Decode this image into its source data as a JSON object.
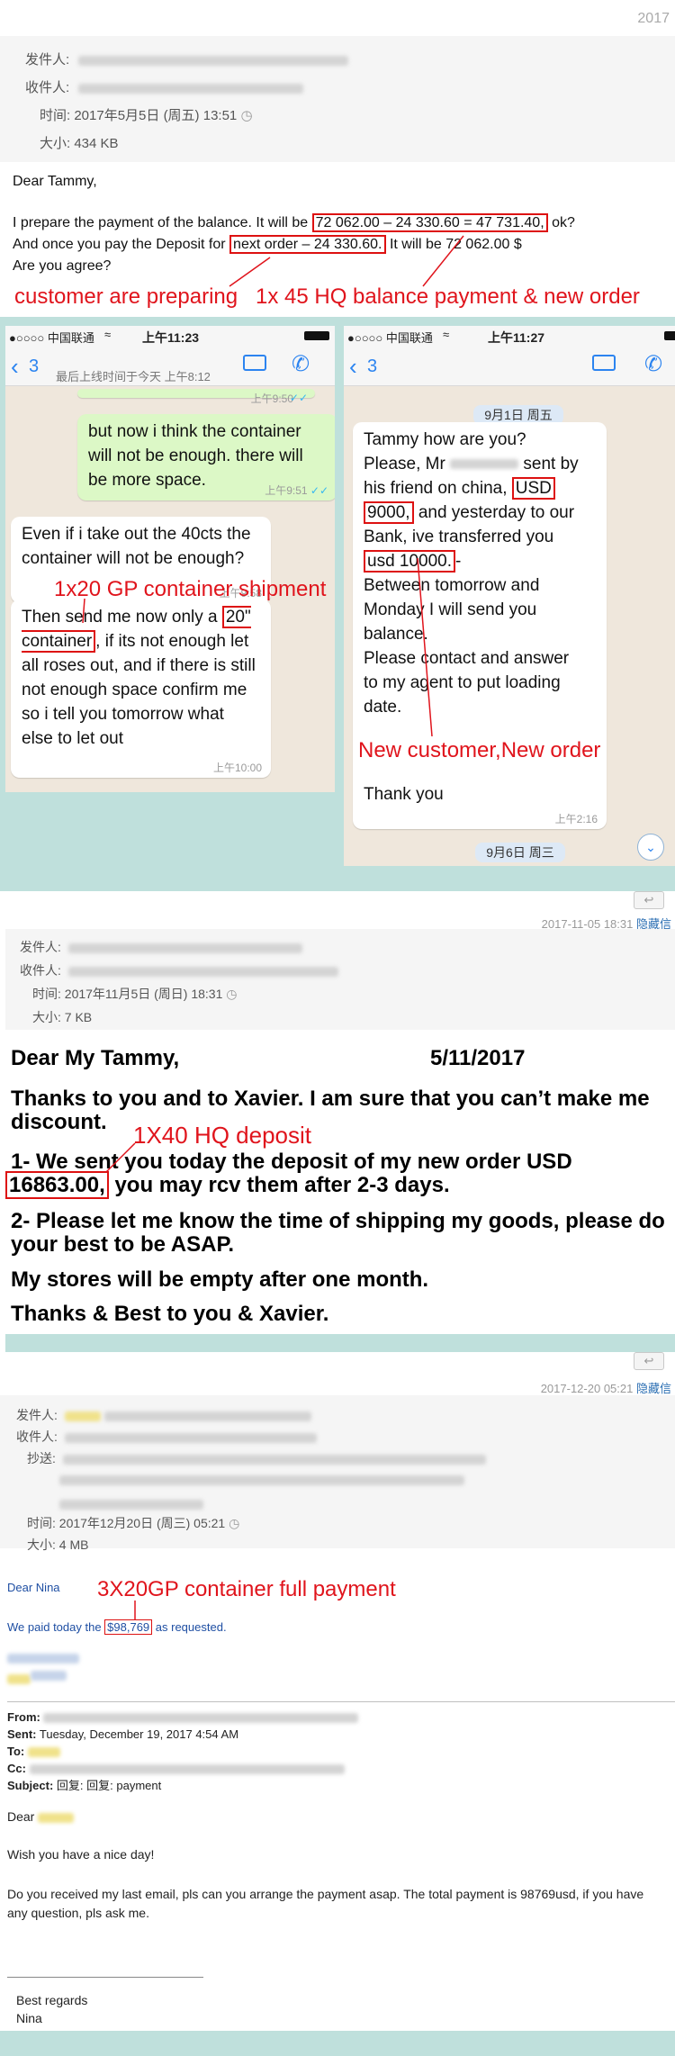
{
  "email1": {
    "year_corner": "2017",
    "from_label": "发件人:",
    "to_label": "收件人:",
    "time_label": "时间:",
    "time_value": "2017年5月5日 (周五) 13:51",
    "size_label": "大小:",
    "size_value": "434 KB",
    "greeting": "Dear Tammy,",
    "line1_a": "I prepare the payment of the balance. It will be ",
    "line1_box": "72 062.00 – 24 330.60 = 47 731.40,",
    "line1_b": " ok?",
    "line2_a": "And once you pay the Deposit for ",
    "line2_box": "next order – 24 330.60.",
    "line2_b": " It will be 72 062.00 $",
    "line3": "Are you agree?",
    "annotation_left": "customer are preparing",
    "annotation_right": "1x 45 HQ balance payment & new order"
  },
  "phone_left": {
    "carrier": "●○○○○ 中国联通",
    "time": "上午11:23",
    "back_count": "3",
    "last_seen": "最后上线时间于今天 上午8:12",
    "top_time": "上午9:50",
    "msg_out": "but now i think the container will not be enough. there will be  more space.",
    "msg_out_time": "上午9:51",
    "msg_in1": "Even if i take out the 40cts the container will not be enough?",
    "msg_in1_time": "上午9:58",
    "msg_in2_a": "Then send me now only a ",
    "msg_in2_box": "20\" container",
    "msg_in2_b": ", if its not enough let all roses out, and if there is still not enough space confirm me so i tell you tomorrow what else to let out",
    "msg_in2_time": "上午10:00",
    "annotation": "1x20 GP container shipment"
  },
  "phone_right": {
    "carrier": "●○○○○ 中国联通",
    "time": "上午11:27",
    "back_count": "3",
    "day1": "9月1日 周五",
    "msg_l1": "Tammy how are you?",
    "msg_l2_a": "Please, Mr ",
    "msg_l2_b": " sent by",
    "msg_l3_a": "his friend on china, ",
    "msg_l3_box": "USD",
    "msg_l4_box": "9000,",
    "msg_l4_b": " and yesterday to our",
    "msg_l5": "Bank,  ive transferred you",
    "msg_l6_box": "usd 10000.",
    "msg_l6_b": "-",
    "msg_l7": "Between tomorrow and",
    "msg_l8": "Monday I will send you",
    "msg_l9": "balance.",
    "msg_l10": "Please contact and answer",
    "msg_l11": "to my agent to put loading",
    "msg_l12": "date.",
    "msg_thanks": "Thank you",
    "msg_time": "上午2:16",
    "day2": "9月6日 周三",
    "annotation": "New customer,New order"
  },
  "email2": {
    "meta_date": "2017-11-05 18:31",
    "meta_link": "隐藏信",
    "from_label": "发件人:",
    "to_label": "收件人:",
    "time_label": "时间:",
    "time_value": "2017年11月5日 (周日) 18:31",
    "size_label": "大小:",
    "size_value": "7 KB",
    "greeting": "Dear My Tammy,",
    "date": "5/11/2017",
    "p1": "Thanks to you and to Xavier. I am sure that you can’t make me discount.",
    "p2_a": "1- We sent you today the deposit of my new order USD",
    "p2_box": "16863.00,",
    "p2_b": " you may rcv them after 2-3 days.",
    "p3": "2- Please let me know the time of shipping my goods, please do your best to be ASAP.",
    "p4": "My stores will be empty after one month.",
    "p5": "Thanks & Best to you & Xavier.",
    "annotation": "1X40 HQ deposit"
  },
  "email3": {
    "meta_date": "2017-12-20 05:21",
    "meta_link": "隐藏信",
    "from_label": "发件人:",
    "to_label": "收件人:",
    "cc_label": "抄送:",
    "time_label": "时间:",
    "time_value": "2017年12月20日 (周三) 05:21",
    "size_label": "大小:",
    "size_value": "4 MB",
    "greeting": "Dear Nina",
    "paid_a": "We paid today the ",
    "paid_box": "$98,769",
    "paid_b": " as requested.",
    "annotation": "3X20GP container full payment",
    "q_from_label": "From:",
    "q_sent_label": "Sent:",
    "q_sent_value": "Tuesday, December 19, 2017 4:54 AM",
    "q_to_label": "To:",
    "q_cc_label": "Cc:",
    "q_subject_label": "Subject:",
    "q_subject_value": "回复: 回复: payment",
    "q_dear": "Dear",
    "q_wish": "Wish you have a nice day!",
    "q_body": "Do you received my last email, pls can you arrange the payment asap. The total payment is 98769usd, if you have any question, pls ask me.",
    "q_regards": "Best regards",
    "q_name": "Nina"
  },
  "colors": {
    "annotation_red": "#e0141c",
    "teal_band": "#bfe0dc",
    "ios_blue": "#2c84f0",
    "chat_bg": "#efe7dc",
    "bubble_out": "#dcf8c6"
  }
}
